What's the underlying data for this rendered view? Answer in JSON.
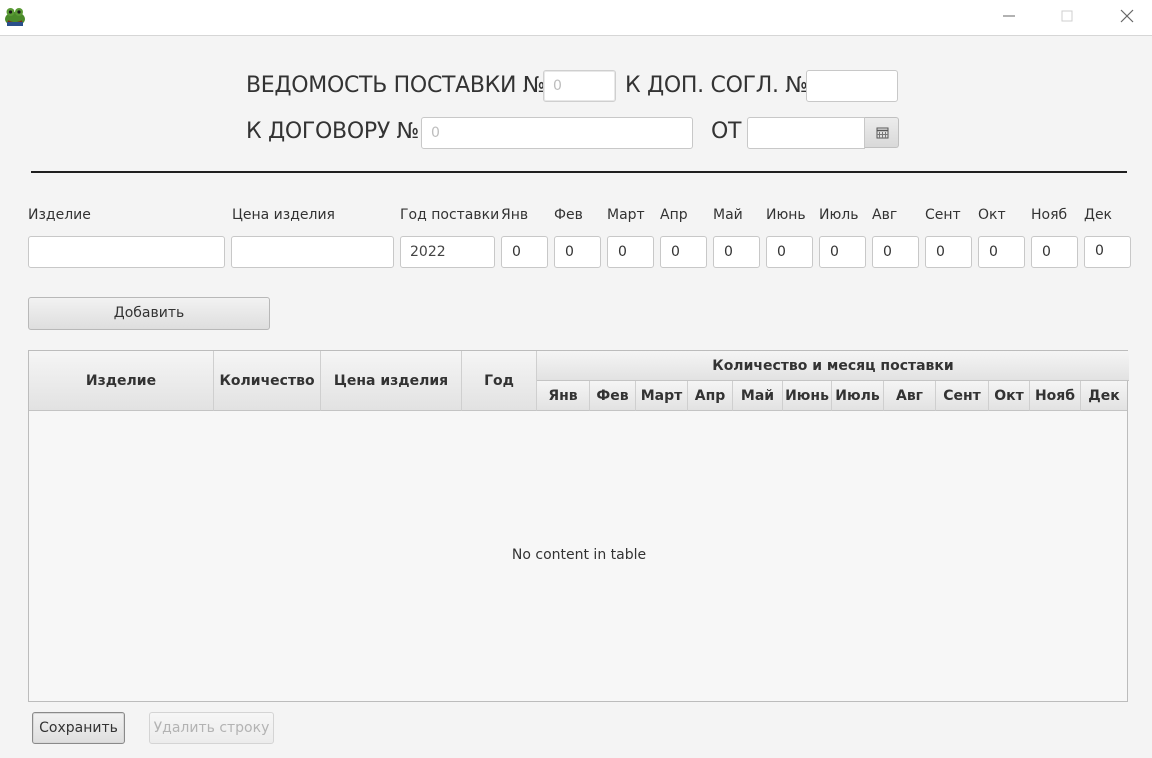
{
  "window": {
    "minimize_symbol": "—",
    "icon": "frog-app-icon"
  },
  "header": {
    "statement_label": "ВЕДОМОСТЬ ПОСТАВКИ №",
    "statement_number_placeholder": "0",
    "addendum_label": "К ДОП. СОГЛ. №",
    "addendum_value": "",
    "contract_label": "К ДОГОВОРУ №",
    "contract_placeholder": "0",
    "date_label": "ОТ",
    "date_value": ""
  },
  "form": {
    "product_label": "Изделие",
    "product_value": "",
    "price_label": "Цена изделия",
    "price_value": "",
    "year_label": "Год поставки",
    "year_value": "2022",
    "months": [
      {
        "label": "Янв",
        "value": "0"
      },
      {
        "label": "Фев",
        "value": "0"
      },
      {
        "label": "Март",
        "value": "0"
      },
      {
        "label": "Апр",
        "value": "0"
      },
      {
        "label": "Май",
        "value": "0"
      },
      {
        "label": "Июнь",
        "value": "0"
      },
      {
        "label": "Июль",
        "value": "0"
      },
      {
        "label": "Авг",
        "value": "0"
      },
      {
        "label": "Сент",
        "value": "0"
      },
      {
        "label": "Окт",
        "value": "0"
      },
      {
        "label": "Нояб",
        "value": "0"
      },
      {
        "label": "Дек",
        "value": "0"
      }
    ],
    "add_button": "Добавить"
  },
  "table": {
    "columns": {
      "product": "Изделие",
      "quantity": "Количество",
      "price": "Цена изделия",
      "year": "Год",
      "group": "Количество и месяц поставки"
    },
    "month_columns": [
      "Янв",
      "Фев",
      "Март",
      "Апр",
      "Май",
      "Июнь",
      "Июль",
      "Авг",
      "Сент",
      "Окт",
      "Нояб",
      "Дек"
    ],
    "empty_message": "No content in table"
  },
  "footer": {
    "save_button": "Сохранить",
    "delete_button": "Удалить строку"
  }
}
